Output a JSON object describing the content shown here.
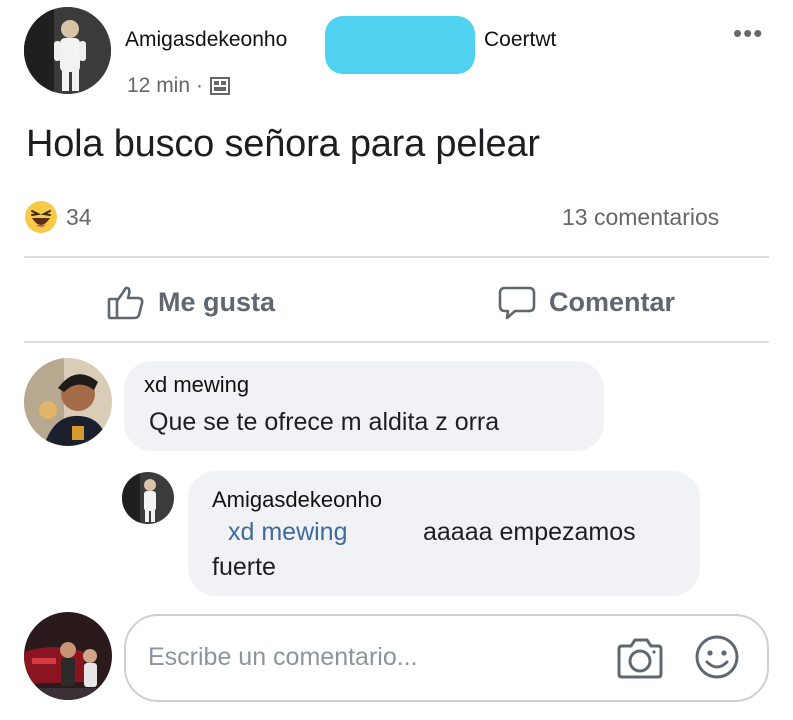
{
  "post": {
    "author": "Amigasdekeonho",
    "tagged": "Coertwt",
    "time": "12 min",
    "separator": "·",
    "privacy_icon": "group-icon",
    "more_icon": "more-horizontal-icon",
    "more_label": "•••",
    "text": "Hola busco señora para pelear",
    "reaction_icon": "haha-emoji-icon",
    "reaction_count": "34",
    "comment_count": "13 comentarios"
  },
  "actions": {
    "like_label": "Me gusta",
    "comment_label": "Comentar",
    "like_icon": "thumbs-up-icon",
    "comment_icon": "speech-bubble-icon"
  },
  "comments": [
    {
      "author": "xd mewing",
      "text": "Que se te ofrece m aldita z orra"
    }
  ],
  "reply": {
    "author": "Amigasdekeonho",
    "mention": "xd mewing",
    "text_a": "aaaaa empezamos",
    "text_b": "fuerte"
  },
  "composer": {
    "placeholder": "Escribe un comentario...",
    "camera_icon": "camera-icon",
    "emoji_icon": "smiley-icon"
  },
  "colors": {
    "redaction": "#4fd2f0",
    "bubble": "#f0f2f5",
    "muted": "#65676b",
    "mention": "#3f6a9c"
  }
}
